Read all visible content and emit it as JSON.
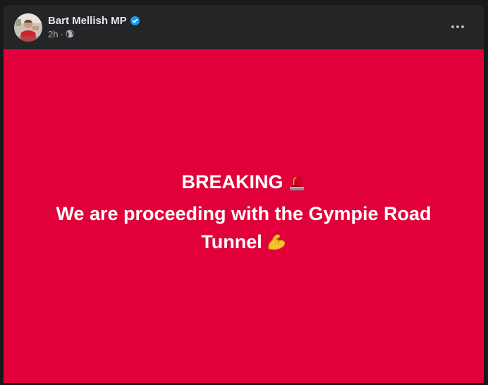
{
  "post": {
    "author": "Bart Mellish MP",
    "verified": true,
    "time": "2h",
    "separator": "·",
    "audience_icon": "globe-icon",
    "more_icon": "more-options-icon"
  },
  "content": {
    "background_color": "#e1003a",
    "line1": "BREAKING",
    "line1_emoji": "police-light-icon",
    "line2": "We are proceeding with the Gympie Road",
    "line3": "Tunnel",
    "line3_emoji": "flexed-bicep-icon"
  },
  "colors": {
    "verified_blue": "#1d9bf0",
    "text_primary": "#e4e6eb",
    "text_secondary": "#b0b3b8"
  }
}
